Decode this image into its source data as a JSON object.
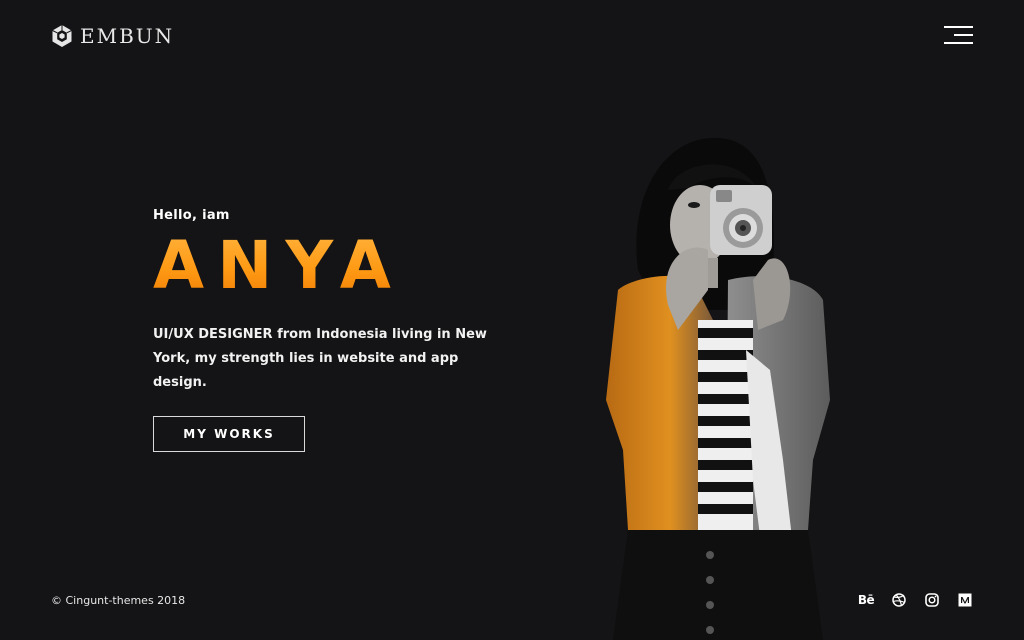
{
  "brand": {
    "name": "EMBUN"
  },
  "hero": {
    "greeting": "Hello, iam",
    "name": "ANYA",
    "description": "UI/UX DESIGNER from Indonesia living in New York, my strength lies in website and app design.",
    "cta_label": "MY WORKS"
  },
  "footer": {
    "copyright": "© Cingunt-themes 2018",
    "social": [
      {
        "icon": "behance-icon",
        "label": "Bē"
      },
      {
        "icon": "dribbble-icon"
      },
      {
        "icon": "instagram-icon"
      },
      {
        "icon": "medium-icon"
      }
    ]
  },
  "colors": {
    "background": "#141315",
    "accent": "#ff9a14",
    "text": "#ffffff"
  }
}
